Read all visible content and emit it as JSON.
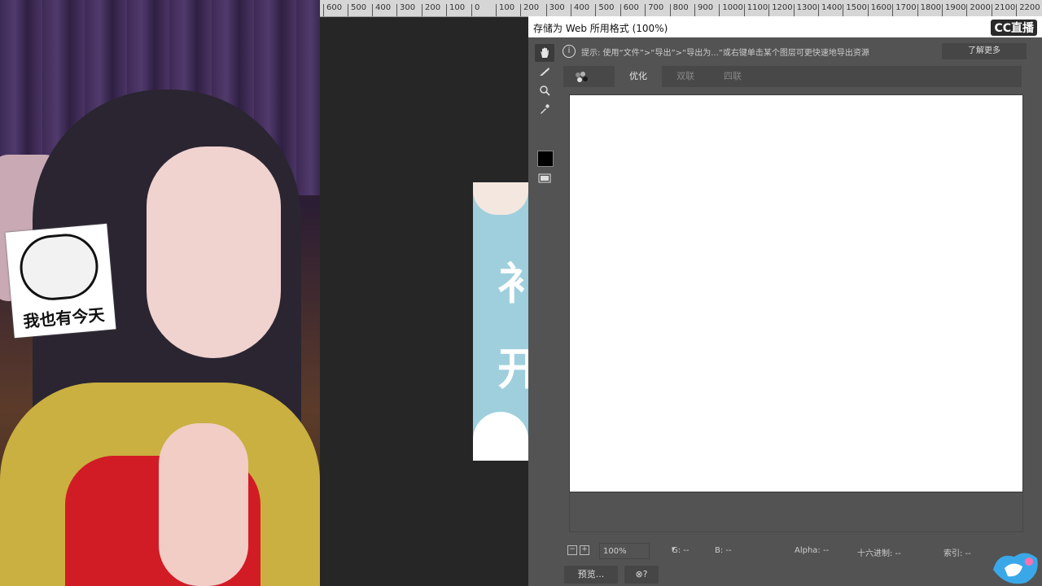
{
  "webcam": {
    "sticker_text": "我也有今天"
  },
  "ruler": {
    "ticks": [
      "600",
      "500",
      "400",
      "300",
      "200",
      "100",
      "0",
      "100",
      "200",
      "300",
      "400",
      "500",
      "600",
      "700",
      "800",
      "900",
      "1000",
      "1100",
      "1200",
      "1300",
      "1400",
      "1500",
      "1600",
      "1700",
      "1800",
      "1900",
      "2000",
      "2100",
      "2200"
    ]
  },
  "document": {
    "glyph_1": "衤",
    "glyph_2": "开"
  },
  "dialog": {
    "title": "存储为 Web 所用格式 (100%)",
    "watermark": "CC直播",
    "hint": "提示: 使用“文件”>“导出”>“导出为...”或右键单击某个图层可更快速地导出资源",
    "learn_more": "了解更多",
    "tabs": [
      "优化",
      "双联",
      "四联"
    ],
    "active_tab": "优化",
    "tools": [
      "hand-icon",
      "slice-select-icon",
      "zoom-icon",
      "eyedropper-icon",
      "color-swatch",
      "toggle-slices-icon"
    ],
    "status": {
      "zoom": "100%",
      "g": "G: --",
      "b": "B: --",
      "alpha": "Alpha: --",
      "hex": "十六进制: --",
      "index": "索引: --"
    },
    "preview_button": "预览...",
    "browser_button": "⊗?"
  }
}
